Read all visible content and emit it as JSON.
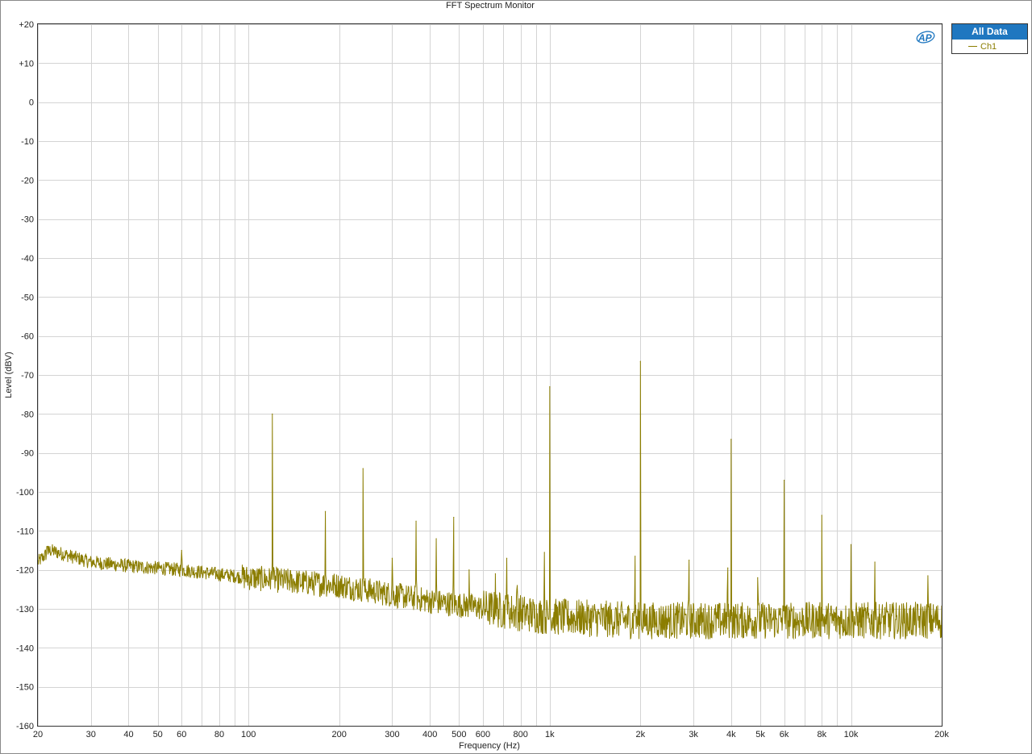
{
  "chart_data": {
    "type": "line",
    "title": "FFT Spectrum Monitor",
    "xlabel": "Frequency (Hz)",
    "ylabel": "Level (dBV)",
    "x_scale": "log",
    "xlim": [
      20,
      20000
    ],
    "ylim": [
      -160,
      20
    ],
    "grid": true,
    "legend_position": "right, outside plot, top",
    "x_ticks": [
      {
        "value": 20,
        "label": "20"
      },
      {
        "value": 30,
        "label": "30"
      },
      {
        "value": 40,
        "label": "40"
      },
      {
        "value": 50,
        "label": "50"
      },
      {
        "value": 60,
        "label": "60"
      },
      {
        "value": 80,
        "label": "80"
      },
      {
        "value": 100,
        "label": "100"
      },
      {
        "value": 200,
        "label": "200"
      },
      {
        "value": 300,
        "label": "300"
      },
      {
        "value": 400,
        "label": "400"
      },
      {
        "value": 500,
        "label": "500"
      },
      {
        "value": 600,
        "label": "600"
      },
      {
        "value": 800,
        "label": "800"
      },
      {
        "value": 1000,
        "label": "1k"
      },
      {
        "value": 2000,
        "label": "2k"
      },
      {
        "value": 3000,
        "label": "3k"
      },
      {
        "value": 4000,
        "label": "4k"
      },
      {
        "value": 5000,
        "label": "5k"
      },
      {
        "value": 6000,
        "label": "6k"
      },
      {
        "value": 8000,
        "label": "8k"
      },
      {
        "value": 10000,
        "label": "10k"
      },
      {
        "value": 20000,
        "label": "20k"
      }
    ],
    "x_grid_values": [
      20,
      30,
      40,
      50,
      60,
      70,
      80,
      90,
      100,
      200,
      300,
      400,
      500,
      600,
      700,
      800,
      900,
      1000,
      2000,
      3000,
      4000,
      5000,
      6000,
      7000,
      8000,
      9000,
      10000,
      20000
    ],
    "y_ticks": [
      {
        "value": 20,
        "label": "+20"
      },
      {
        "value": 10,
        "label": "+10"
      },
      {
        "value": 0,
        "label": "0"
      },
      {
        "value": -10,
        "label": "-10"
      },
      {
        "value": -20,
        "label": "-20"
      },
      {
        "value": -30,
        "label": "-30"
      },
      {
        "value": -40,
        "label": "-40"
      },
      {
        "value": -50,
        "label": "-50"
      },
      {
        "value": -60,
        "label": "-60"
      },
      {
        "value": -70,
        "label": "-70"
      },
      {
        "value": -80,
        "label": "-80"
      },
      {
        "value": -90,
        "label": "-90"
      },
      {
        "value": -100,
        "label": "-100"
      },
      {
        "value": -110,
        "label": "-110"
      },
      {
        "value": -120,
        "label": "-120"
      },
      {
        "value": -130,
        "label": "-130"
      },
      {
        "value": -140,
        "label": "-140"
      },
      {
        "value": -150,
        "label": "-150"
      },
      {
        "value": -160,
        "label": "-160"
      }
    ],
    "legend_header": "All Data",
    "series": [
      {
        "name": "Ch1",
        "color": "#8b7d00",
        "noise_floor": [
          [
            20,
            -118
          ],
          [
            22,
            -115
          ],
          [
            30,
            -118
          ],
          [
            40,
            -119
          ],
          [
            60,
            -120
          ],
          [
            100,
            -122
          ],
          [
            200,
            -124
          ],
          [
            400,
            -128
          ],
          [
            1000,
            -132
          ],
          [
            2000,
            -133
          ],
          [
            5000,
            -133
          ],
          [
            10000,
            -133
          ],
          [
            20000,
            -133
          ]
        ],
        "noise_amplitude_db": 3,
        "peaks": [
          {
            "x": 21.5,
            "y": -114
          },
          {
            "x": 60,
            "y": -115
          },
          {
            "x": 120,
            "y": -80
          },
          {
            "x": 180,
            "y": -105
          },
          {
            "x": 240,
            "y": -94
          },
          {
            "x": 300,
            "y": -117
          },
          {
            "x": 360,
            "y": -107.5
          },
          {
            "x": 420,
            "y": -112
          },
          {
            "x": 480,
            "y": -106.5
          },
          {
            "x": 540,
            "y": -120
          },
          {
            "x": 660,
            "y": -121
          },
          {
            "x": 720,
            "y": -117
          },
          {
            "x": 780,
            "y": -124
          },
          {
            "x": 960,
            "y": -115.5
          },
          {
            "x": 1000,
            "y": -73
          },
          {
            "x": 1920,
            "y": -116.5
          },
          {
            "x": 2000,
            "y": -66.5
          },
          {
            "x": 2900,
            "y": -117.5
          },
          {
            "x": 3900,
            "y": -119.5
          },
          {
            "x": 4000,
            "y": -86.5
          },
          {
            "x": 4900,
            "y": -122
          },
          {
            "x": 6000,
            "y": -97
          },
          {
            "x": 8000,
            "y": -106
          },
          {
            "x": 10000,
            "y": -113.5
          },
          {
            "x": 12000,
            "y": -118
          },
          {
            "x": 18000,
            "y": -121.5
          }
        ]
      }
    ]
  }
}
